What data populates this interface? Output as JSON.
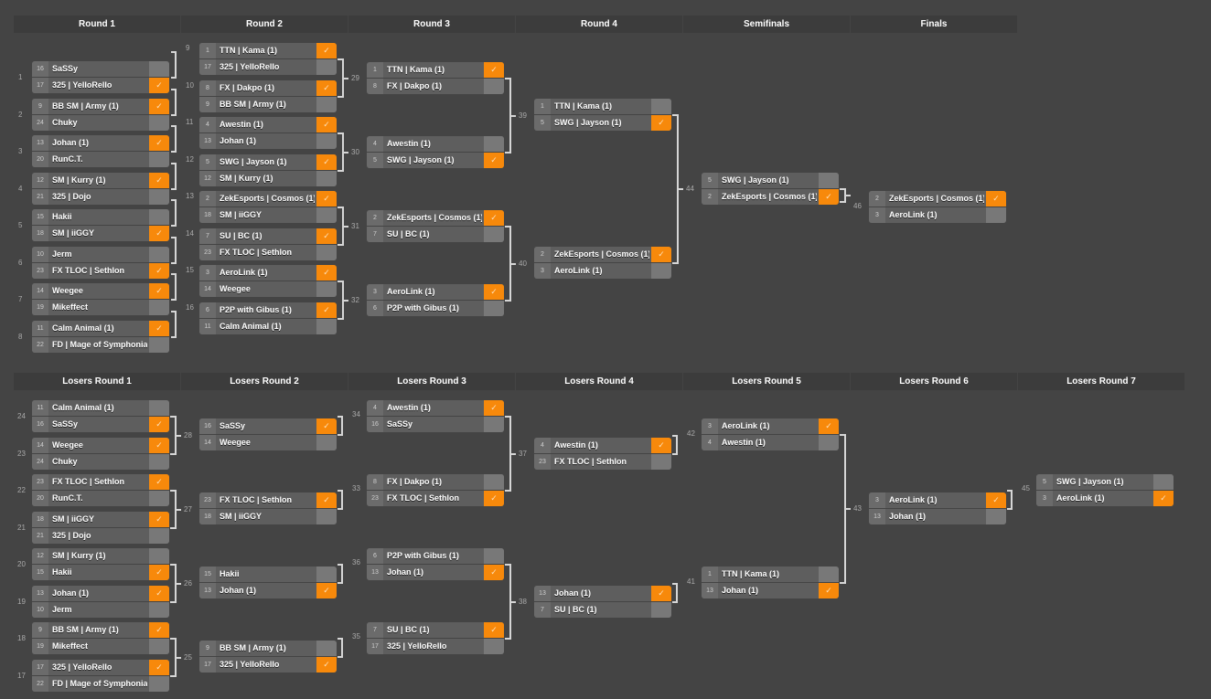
{
  "winners_bracket": {
    "headers": [
      "Round 1",
      "Round 2",
      "Round 3",
      "Round 4",
      "Semifinals",
      "Finals"
    ],
    "rounds": [
      {
        "matches": [
          {
            "id": "1",
            "teams": [
              {
                "seed": "16",
                "name": "SaSSy",
                "win": false
              },
              {
                "seed": "17",
                "name": "325 | YelloRello",
                "win": true
              }
            ]
          },
          {
            "id": "2",
            "teams": [
              {
                "seed": "9",
                "name": "BB SM | Army (1)",
                "win": true
              },
              {
                "seed": "24",
                "name": "Chuky",
                "win": false
              }
            ]
          },
          {
            "id": "3",
            "teams": [
              {
                "seed": "13",
                "name": "Johan (1)",
                "win": true
              },
              {
                "seed": "20",
                "name": "RunC.T.",
                "win": false
              }
            ]
          },
          {
            "id": "4",
            "teams": [
              {
                "seed": "12",
                "name": "SM | Kurry (1)",
                "win": true
              },
              {
                "seed": "21",
                "name": "325 | Dojo",
                "win": false
              }
            ]
          },
          {
            "id": "5",
            "teams": [
              {
                "seed": "15",
                "name": "Hakii",
                "win": false
              },
              {
                "seed": "18",
                "name": "SM | iiGGY",
                "win": true
              }
            ]
          },
          {
            "id": "6",
            "teams": [
              {
                "seed": "10",
                "name": "Jerm",
                "win": false
              },
              {
                "seed": "23",
                "name": "FX TLOC | Sethlon",
                "win": true
              }
            ]
          },
          {
            "id": "7",
            "teams": [
              {
                "seed": "14",
                "name": "Weegee",
                "win": true
              },
              {
                "seed": "19",
                "name": "Mikeffect",
                "win": false
              }
            ]
          },
          {
            "id": "8",
            "teams": [
              {
                "seed": "11",
                "name": "Calm Animal (1)",
                "win": true
              },
              {
                "seed": "22",
                "name": "FD | Mage of Symphonia",
                "win": false
              }
            ]
          }
        ]
      },
      {
        "matches": [
          {
            "id": "9",
            "teams": [
              {
                "seed": "1",
                "name": "TTN | Kama (1)",
                "win": true
              },
              {
                "seed": "17",
                "name": "325 | YelloRello",
                "win": false
              }
            ]
          },
          {
            "id": "10",
            "teams": [
              {
                "seed": "8",
                "name": "FX | Dakpo (1)",
                "win": true
              },
              {
                "seed": "9",
                "name": "BB SM | Army (1)",
                "win": false
              }
            ]
          },
          {
            "id": "11",
            "teams": [
              {
                "seed": "4",
                "name": "Awestin (1)",
                "win": true
              },
              {
                "seed": "13",
                "name": "Johan (1)",
                "win": false
              }
            ]
          },
          {
            "id": "12",
            "teams": [
              {
                "seed": "5",
                "name": "SWG | Jayson (1)",
                "win": true
              },
              {
                "seed": "12",
                "name": "SM | Kurry (1)",
                "win": false
              }
            ]
          },
          {
            "id": "13",
            "teams": [
              {
                "seed": "2",
                "name": "ZekEsports | Cosmos (1)",
                "win": true
              },
              {
                "seed": "18",
                "name": "SM | iiGGY",
                "win": false
              }
            ]
          },
          {
            "id": "14",
            "teams": [
              {
                "seed": "7",
                "name": "SU | BC (1)",
                "win": true
              },
              {
                "seed": "23",
                "name": "FX TLOC | Sethlon",
                "win": false
              }
            ]
          },
          {
            "id": "15",
            "teams": [
              {
                "seed": "3",
                "name": "AeroLink (1)",
                "win": true
              },
              {
                "seed": "14",
                "name": "Weegee",
                "win": false
              }
            ]
          },
          {
            "id": "16",
            "teams": [
              {
                "seed": "6",
                "name": "P2P with Gibus (1)",
                "win": true
              },
              {
                "seed": "11",
                "name": "Calm Animal (1)",
                "win": false
              }
            ]
          }
        ]
      },
      {
        "matches": [
          {
            "id": "29",
            "teams": [
              {
                "seed": "1",
                "name": "TTN | Kama (1)",
                "win": true
              },
              {
                "seed": "8",
                "name": "FX | Dakpo (1)",
                "win": false
              }
            ]
          },
          {
            "id": "30",
            "teams": [
              {
                "seed": "4",
                "name": "Awestin (1)",
                "win": false
              },
              {
                "seed": "5",
                "name": "SWG | Jayson (1)",
                "win": true
              }
            ]
          },
          {
            "id": "31",
            "teams": [
              {
                "seed": "2",
                "name": "ZekEsports | Cosmos (1)",
                "win": true
              },
              {
                "seed": "7",
                "name": "SU | BC (1)",
                "win": false
              }
            ]
          },
          {
            "id": "32",
            "teams": [
              {
                "seed": "3",
                "name": "AeroLink (1)",
                "win": true
              },
              {
                "seed": "6",
                "name": "P2P with Gibus (1)",
                "win": false
              }
            ]
          }
        ]
      },
      {
        "matches": [
          {
            "id": "39",
            "teams": [
              {
                "seed": "1",
                "name": "TTN | Kama (1)",
                "win": false
              },
              {
                "seed": "5",
                "name": "SWG | Jayson (1)",
                "win": true
              }
            ]
          },
          {
            "id": "40",
            "teams": [
              {
                "seed": "2",
                "name": "ZekEsports | Cosmos (1)",
                "win": true
              },
              {
                "seed": "3",
                "name": "AeroLink (1)",
                "win": false
              }
            ]
          }
        ]
      },
      {
        "matches": [
          {
            "id": "44",
            "teams": [
              {
                "seed": "5",
                "name": "SWG | Jayson (1)",
                "win": false
              },
              {
                "seed": "2",
                "name": "ZekEsports | Cosmos (1)",
                "win": true
              }
            ]
          }
        ]
      },
      {
        "matches": [
          {
            "id": "46",
            "teams": [
              {
                "seed": "2",
                "name": "ZekEsports | Cosmos (1)",
                "win": true
              },
              {
                "seed": "3",
                "name": "AeroLink (1)",
                "win": false
              }
            ]
          }
        ]
      }
    ]
  },
  "losers_bracket": {
    "headers": [
      "Losers Round 1",
      "Losers Round 2",
      "Losers Round 3",
      "Losers Round 4",
      "Losers Round 5",
      "Losers Round 6",
      "Losers Round 7"
    ],
    "rounds": [
      {
        "matches": [
          {
            "id": "24",
            "teams": [
              {
                "seed": "11",
                "name": "Calm Animal (1)",
                "win": false
              },
              {
                "seed": "16",
                "name": "SaSSy",
                "win": true
              }
            ]
          },
          {
            "id": "23",
            "teams": [
              {
                "seed": "14",
                "name": "Weegee",
                "win": true
              },
              {
                "seed": "24",
                "name": "Chuky",
                "win": false
              }
            ]
          },
          {
            "id": "22",
            "teams": [
              {
                "seed": "23",
                "name": "FX TLOC | Sethlon",
                "win": true
              },
              {
                "seed": "20",
                "name": "RunC.T.",
                "win": false
              }
            ]
          },
          {
            "id": "21",
            "teams": [
              {
                "seed": "18",
                "name": "SM | iiGGY",
                "win": true
              },
              {
                "seed": "21",
                "name": "325 | Dojo",
                "win": false
              }
            ]
          },
          {
            "id": "20",
            "teams": [
              {
                "seed": "12",
                "name": "SM | Kurry (1)",
                "win": false
              },
              {
                "seed": "15",
                "name": "Hakii",
                "win": true
              }
            ]
          },
          {
            "id": "19",
            "teams": [
              {
                "seed": "13",
                "name": "Johan (1)",
                "win": true
              },
              {
                "seed": "10",
                "name": "Jerm",
                "win": false
              }
            ]
          },
          {
            "id": "18",
            "teams": [
              {
                "seed": "9",
                "name": "BB SM | Army (1)",
                "win": true
              },
              {
                "seed": "19",
                "name": "Mikeffect",
                "win": false
              }
            ]
          },
          {
            "id": "17",
            "teams": [
              {
                "seed": "17",
                "name": "325 | YelloRello",
                "win": true
              },
              {
                "seed": "22",
                "name": "FD | Mage of Symphonia",
                "win": false
              }
            ]
          }
        ]
      },
      {
        "matches": [
          {
            "id": "28",
            "teams": [
              {
                "seed": "16",
                "name": "SaSSy",
                "win": true
              },
              {
                "seed": "14",
                "name": "Weegee",
                "win": false
              }
            ]
          },
          {
            "id": "27",
            "teams": [
              {
                "seed": "23",
                "name": "FX TLOC | Sethlon",
                "win": true
              },
              {
                "seed": "18",
                "name": "SM | iiGGY",
                "win": false
              }
            ]
          },
          {
            "id": "26",
            "teams": [
              {
                "seed": "15",
                "name": "Hakii",
                "win": false
              },
              {
                "seed": "13",
                "name": "Johan (1)",
                "win": true
              }
            ]
          },
          {
            "id": "25",
            "teams": [
              {
                "seed": "9",
                "name": "BB SM | Army (1)",
                "win": false
              },
              {
                "seed": "17",
                "name": "325 | YelloRello",
                "win": true
              }
            ]
          }
        ]
      },
      {
        "matches": [
          {
            "id": "34",
            "teams": [
              {
                "seed": "4",
                "name": "Awestin (1)",
                "win": true
              },
              {
                "seed": "16",
                "name": "SaSSy",
                "win": false
              }
            ]
          },
          {
            "id": "33",
            "teams": [
              {
                "seed": "8",
                "name": "FX | Dakpo (1)",
                "win": false
              },
              {
                "seed": "23",
                "name": "FX TLOC | Sethlon",
                "win": true
              }
            ]
          },
          {
            "id": "36",
            "teams": [
              {
                "seed": "6",
                "name": "P2P with Gibus (1)",
                "win": false
              },
              {
                "seed": "13",
                "name": "Johan (1)",
                "win": true
              }
            ]
          },
          {
            "id": "35",
            "teams": [
              {
                "seed": "7",
                "name": "SU | BC (1)",
                "win": true
              },
              {
                "seed": "17",
                "name": "325 | YelloRello",
                "win": false
              }
            ]
          }
        ]
      },
      {
        "matches": [
          {
            "id": "37",
            "teams": [
              {
                "seed": "4",
                "name": "Awestin (1)",
                "win": true
              },
              {
                "seed": "23",
                "name": "FX TLOC | Sethlon",
                "win": false
              }
            ]
          },
          {
            "id": "38",
            "teams": [
              {
                "seed": "13",
                "name": "Johan (1)",
                "win": true
              },
              {
                "seed": "7",
                "name": "SU | BC (1)",
                "win": false
              }
            ]
          }
        ]
      },
      {
        "matches": [
          {
            "id": "42",
            "teams": [
              {
                "seed": "3",
                "name": "AeroLink (1)",
                "win": true
              },
              {
                "seed": "4",
                "name": "Awestin (1)",
                "win": false
              }
            ]
          },
          {
            "id": "41",
            "teams": [
              {
                "seed": "1",
                "name": "TTN | Kama (1)",
                "win": false
              },
              {
                "seed": "13",
                "name": "Johan (1)",
                "win": true
              }
            ]
          }
        ]
      },
      {
        "matches": [
          {
            "id": "43",
            "teams": [
              {
                "seed": "3",
                "name": "AeroLink (1)",
                "win": true
              },
              {
                "seed": "13",
                "name": "Johan (1)",
                "win": false
              }
            ]
          }
        ]
      },
      {
        "matches": [
          {
            "id": "45",
            "teams": [
              {
                "seed": "5",
                "name": "SWG | Jayson (1)",
                "win": false
              },
              {
                "seed": "3",
                "name": "AeroLink (1)",
                "win": true
              }
            ]
          }
        ]
      }
    ]
  },
  "icons": {
    "winner_check": "✓"
  },
  "colors": {
    "background": "#444444",
    "header": "#3c3c3c",
    "winner": "#f7890b",
    "row": "#5e5e5e",
    "score": "#787878",
    "connector": "#d6d6d6"
  }
}
